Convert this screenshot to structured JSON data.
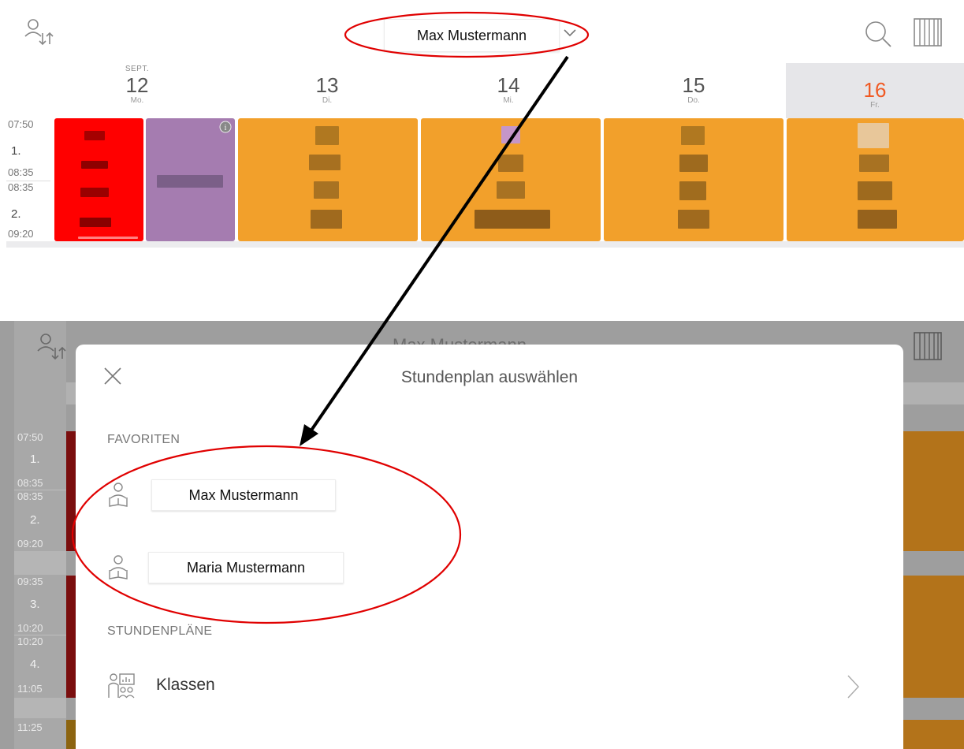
{
  "top": {
    "teacher_name": "Max Mustermann",
    "days": [
      {
        "month": "SEPT.",
        "num": "12",
        "name": "Mo."
      },
      {
        "month": "",
        "num": "13",
        "name": "Di."
      },
      {
        "month": "",
        "num": "14",
        "name": "Mi."
      },
      {
        "month": "",
        "num": "15",
        "name": "Do."
      },
      {
        "month": "",
        "num": "16",
        "name": "Fr.",
        "today": true
      }
    ],
    "times": [
      {
        "start": "07:50",
        "period": "1.",
        "end": "08:35"
      },
      {
        "start": "08:35",
        "period": "2.",
        "end": "09:20"
      }
    ],
    "colors": {
      "red": "#ff0000",
      "purple": "#a57cb0",
      "orange": "#f2a02b",
      "today_accent": "#f05a24"
    }
  },
  "bottom": {
    "background_title": "Max Mustermann",
    "times": [
      {
        "start": "07:50",
        "period": "1.",
        "end": "08:35"
      },
      {
        "start": "08:35",
        "period": "2.",
        "end": "09:20"
      },
      {
        "start": "09:35",
        "period": "3.",
        "end": "10:20"
      },
      {
        "start": "10:20",
        "period": "4.",
        "end": "11:05"
      },
      {
        "start": "11:25"
      }
    ],
    "modal": {
      "title": "Stundenplan auswählen",
      "favorites_label": "FAVORITEN",
      "favorites": [
        {
          "name": "Max Mustermann",
          "icon": "reading-person-icon"
        },
        {
          "name": "Maria Mustermann",
          "icon": "reading-person-icon"
        }
      ],
      "timetables_label": "STUNDENPLÄNE",
      "timetables": [
        {
          "label": "Klassen",
          "icon": "class-icon"
        }
      ]
    }
  },
  "annotation": {
    "ellipse_color": "#e00000",
    "arrow_color": "#000000"
  }
}
